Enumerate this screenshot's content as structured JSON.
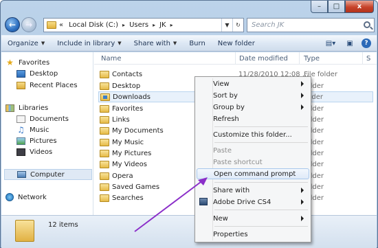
{
  "address": {
    "nav_history_glyph": "«",
    "crumbs": [
      "Local Disk (C:)",
      "Users",
      "JK"
    ],
    "sep": "▸"
  },
  "search": {
    "placeholder": "Search JK"
  },
  "window_buttons": {
    "minimize": "–",
    "maximize": "□",
    "close": "x"
  },
  "toolbar": {
    "organize": "Organize",
    "include_in_library": "Include in library",
    "share_with": "Share with",
    "burn": "Burn",
    "new_folder": "New folder",
    "help": "?"
  },
  "nav": {
    "favorites": "Favorites",
    "desktop": "Desktop",
    "recent_places": "Recent Places",
    "libraries": "Libraries",
    "documents": "Documents",
    "music": "Music",
    "pictures": "Pictures",
    "videos": "Videos",
    "computer": "Computer",
    "network": "Network"
  },
  "columns": {
    "name": "Name",
    "date_modified": "Date modified",
    "type": "Type",
    "size": "S"
  },
  "files": [
    {
      "name": "Contacts",
      "date": "11/28/2010 12:08 ...",
      "type": "File folder"
    },
    {
      "name": "Desktop",
      "date": "",
      "type": "folder"
    },
    {
      "name": "Downloads",
      "date": "",
      "type": "folder"
    },
    {
      "name": "Favorites",
      "date": "",
      "type": "folder"
    },
    {
      "name": "Links",
      "date": "",
      "type": "folder"
    },
    {
      "name": "My Documents",
      "date": "",
      "type": "folder"
    },
    {
      "name": "My Music",
      "date": "",
      "type": "folder"
    },
    {
      "name": "My Pictures",
      "date": "",
      "type": "folder"
    },
    {
      "name": "My Videos",
      "date": "",
      "type": "folder"
    },
    {
      "name": "Opera",
      "date": "",
      "type": "folder"
    },
    {
      "name": "Saved Games",
      "date": "",
      "type": "folder"
    },
    {
      "name": "Searches",
      "date": "",
      "type": "folder"
    }
  ],
  "context_menu": {
    "view": "View",
    "sort_by": "Sort by",
    "group_by": "Group by",
    "refresh": "Refresh",
    "customize": "Customize this folder...",
    "paste": "Paste",
    "paste_shortcut": "Paste shortcut",
    "open_cmd": "Open command prompt",
    "share_with": "Share with",
    "adobe_drive": "Adobe Drive CS4",
    "new": "New",
    "properties": "Properties"
  },
  "status": {
    "item_count": "12 items"
  },
  "colors": {
    "arrow": "#8b2fc9",
    "highlight": "#dfeaf8",
    "accent": "#2c6ab8"
  },
  "icons": [
    "back-arrow-icon",
    "forward-arrow-icon",
    "folder-icon",
    "search-icon",
    "star-icon",
    "computer-icon",
    "network-icon",
    "help-icon",
    "adobe-drive-icon"
  ]
}
